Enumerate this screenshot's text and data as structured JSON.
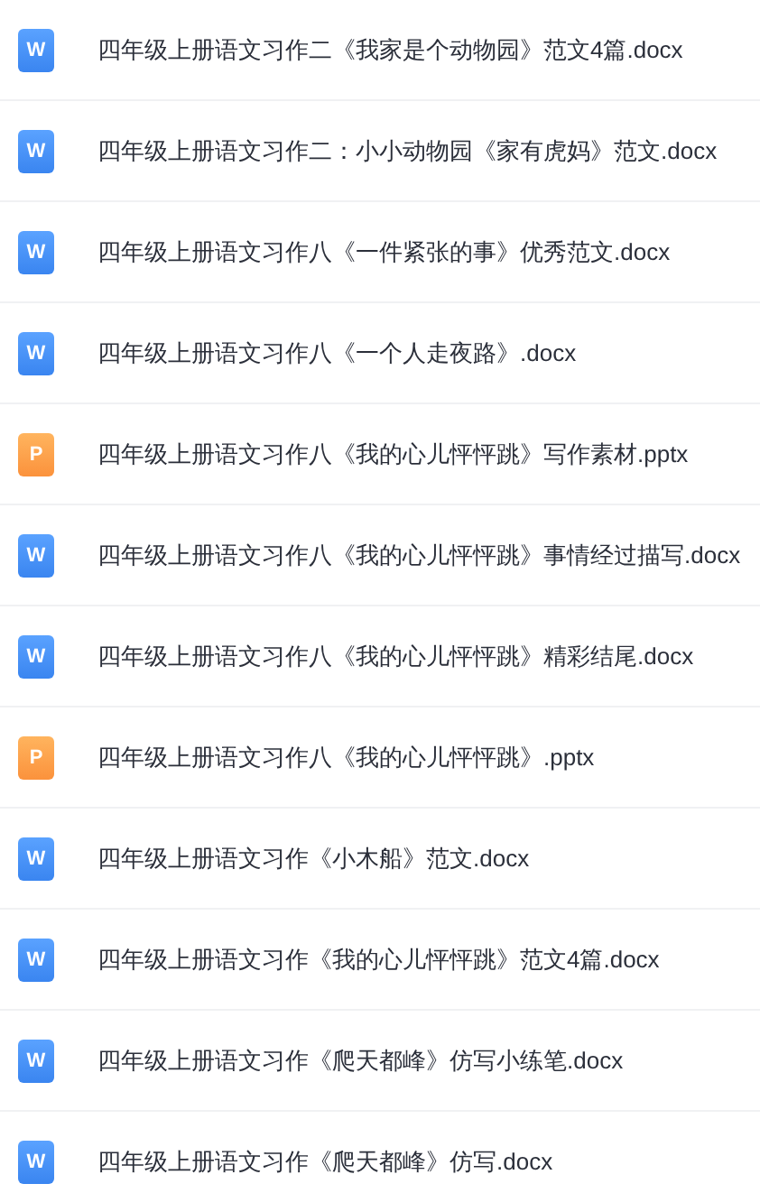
{
  "files": [
    {
      "kind": "docx",
      "icon_letter": "W",
      "name": "四年级上册语文习作二《我家是个动物园》范文4篇.docx"
    },
    {
      "kind": "docx",
      "icon_letter": "W",
      "name": "四年级上册语文习作二：小小动物园《家有虎妈》范文.docx"
    },
    {
      "kind": "docx",
      "icon_letter": "W",
      "name": "四年级上册语文习作八《一件紧张的事》优秀范文.docx"
    },
    {
      "kind": "docx",
      "icon_letter": "W",
      "name": "四年级上册语文习作八《一个人走夜路》.docx"
    },
    {
      "kind": "pptx",
      "icon_letter": "P",
      "name": "四年级上册语文习作八《我的心儿怦怦跳》写作素材.pptx"
    },
    {
      "kind": "docx",
      "icon_letter": "W",
      "name": "四年级上册语文习作八《我的心儿怦怦跳》事情经过描写.docx"
    },
    {
      "kind": "docx",
      "icon_letter": "W",
      "name": "四年级上册语文习作八《我的心儿怦怦跳》精彩结尾.docx"
    },
    {
      "kind": "pptx",
      "icon_letter": "P",
      "name": "四年级上册语文习作八《我的心儿怦怦跳》.pptx"
    },
    {
      "kind": "docx",
      "icon_letter": "W",
      "name": "四年级上册语文习作《小木船》范文.docx"
    },
    {
      "kind": "docx",
      "icon_letter": "W",
      "name": "四年级上册语文习作《我的心儿怦怦跳》范文4篇.docx"
    },
    {
      "kind": "docx",
      "icon_letter": "W",
      "name": "四年级上册语文习作《爬天都峰》仿写小练笔.docx"
    },
    {
      "kind": "docx",
      "icon_letter": "W",
      "name": "四年级上册语文习作《爬天都峰》仿写.docx"
    }
  ]
}
